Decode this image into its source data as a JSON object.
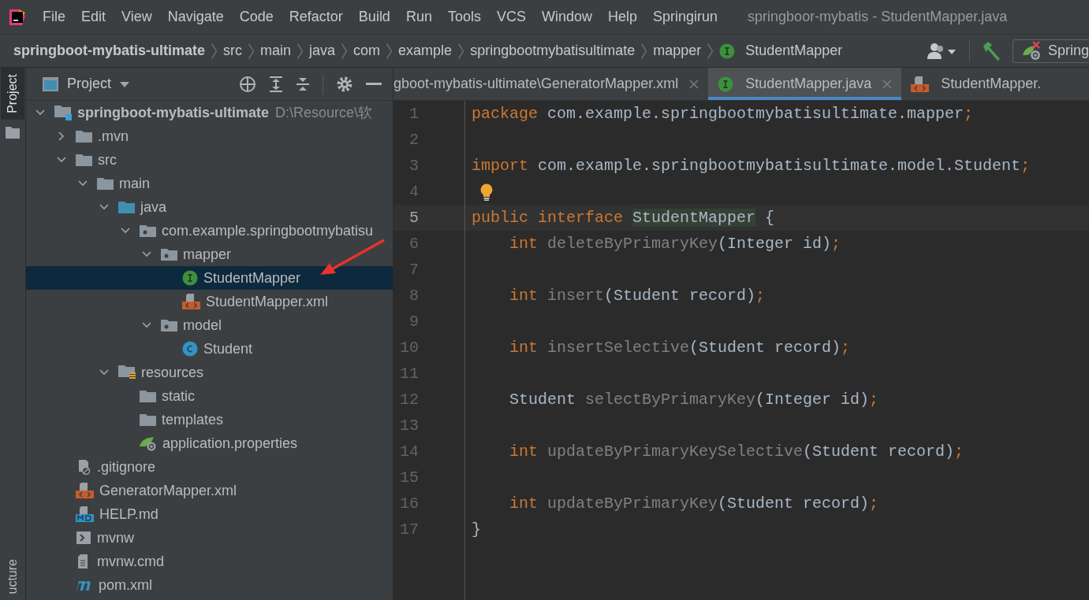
{
  "menu_bar": {
    "items": [
      "File",
      "Edit",
      "View",
      "Navigate",
      "Code",
      "Refactor",
      "Build",
      "Run",
      "Tools",
      "VCS",
      "Window",
      "Help",
      "Springirun"
    ],
    "title": "springboor-mybatis - StudentMapper.java"
  },
  "breadcrumb": {
    "items": [
      {
        "label": "springboot-mybatis-ultimate",
        "kind": "project"
      },
      {
        "label": "src",
        "kind": "dir"
      },
      {
        "label": "main",
        "kind": "dir"
      },
      {
        "label": "java",
        "kind": "dir"
      },
      {
        "label": "com",
        "kind": "dir"
      },
      {
        "label": "example",
        "kind": "dir"
      },
      {
        "label": "springbootmybatisultimate",
        "kind": "dir"
      },
      {
        "label": "mapper",
        "kind": "dir"
      },
      {
        "label": "StudentMapper",
        "kind": "interface"
      }
    ],
    "run_config": "Spring"
  },
  "tool_stripe": [
    {
      "label": "Project",
      "selected": true
    },
    {
      "label": "ucture",
      "selected": false
    }
  ],
  "project_panel": {
    "title": "Project",
    "tree": [
      {
        "label": "springboot-mybatis-ultimate",
        "path": "D:\\Resource\\软",
        "kind": "module",
        "expanded": true,
        "selected": false,
        "children": [
          {
            "label": ".mvn",
            "kind": "folder",
            "expanded": false,
            "selected": false
          },
          {
            "label": "src",
            "kind": "folder",
            "expanded": true,
            "selected": false,
            "children": [
              {
                "label": "main",
                "kind": "folder",
                "expanded": true,
                "selected": false,
                "children": [
                  {
                    "label": "java",
                    "kind": "source",
                    "expanded": true,
                    "selected": false,
                    "children": [
                      {
                        "label": "com.example.springbootmybatisu",
                        "kind": "package",
                        "expanded": true,
                        "selected": false,
                        "children": [
                          {
                            "label": "mapper",
                            "kind": "package",
                            "expanded": true,
                            "selected": false,
                            "children": [
                              {
                                "label": "StudentMapper",
                                "kind": "interface",
                                "selected": true
                              },
                              {
                                "label": "StudentMapper.xml",
                                "kind": "xml",
                                "selected": false
                              }
                            ]
                          },
                          {
                            "label": "model",
                            "kind": "package",
                            "expanded": true,
                            "selected": false,
                            "children": [
                              {
                                "label": "Student",
                                "kind": "class",
                                "selected": false
                              }
                            ]
                          }
                        ]
                      }
                    ]
                  },
                  {
                    "label": "resources",
                    "kind": "resources",
                    "expanded": true,
                    "selected": false,
                    "children": [
                      {
                        "label": "static",
                        "kind": "folder",
                        "selected": false
                      },
                      {
                        "label": "templates",
                        "kind": "folder",
                        "selected": false
                      },
                      {
                        "label": "application.properties",
                        "kind": "spring",
                        "selected": false
                      }
                    ]
                  }
                ]
              }
            ]
          },
          {
            "label": ".gitignore",
            "kind": "gitignore",
            "selected": false
          },
          {
            "label": "GeneratorMapper.xml",
            "kind": "xml",
            "selected": false
          },
          {
            "label": "HELP.md",
            "kind": "markdown",
            "selected": false
          },
          {
            "label": "mvnw",
            "kind": "script",
            "selected": false
          },
          {
            "label": "mvnw.cmd",
            "kind": "text",
            "selected": false
          },
          {
            "label": "pom.xml",
            "kind": "maven",
            "selected": false
          }
        ]
      }
    ]
  },
  "editor_tabs": [
    {
      "label": "gboot-mybatis-ultimate\\GeneratorMapper.xml",
      "selected": false,
      "closable": true
    },
    {
      "label": "StudentMapper.java",
      "kind": "interface",
      "selected": true,
      "closable": true
    },
    {
      "label": "StudentMapper.",
      "kind": "xml",
      "selected": false,
      "closable": false
    }
  ],
  "code": [
    {
      "number": "1",
      "current": false,
      "indented": false,
      "tokens": [
        {
          "text": "package ",
          "kind": "keyword"
        },
        {
          "text": "com.example.springbootmybatisultimate.mapper",
          "kind": "plain"
        },
        {
          "text": ";",
          "kind": "punct"
        }
      ]
    },
    {
      "number": "2",
      "current": false
    },
    {
      "number": "3",
      "current": false,
      "indented": false,
      "tokens": [
        {
          "text": "import ",
          "kind": "keyword"
        },
        {
          "text": "com.example.springbootmybatisultimate.model.Student",
          "kind": "plain"
        },
        {
          "text": ";",
          "kind": "punct"
        }
      ]
    },
    {
      "number": "4",
      "current": false,
      "lightbulb": true
    },
    {
      "number": "5",
      "current": true,
      "indented": false,
      "tokens": [
        {
          "text": "public interface ",
          "kind": "keyword"
        },
        {
          "text": "StudentMapper",
          "kind": "highlight"
        },
        {
          "text": " {",
          "kind": "plain"
        }
      ]
    },
    {
      "number": "6",
      "current": false,
      "indented": true,
      "tokens": [
        {
          "text": "int ",
          "kind": "keyword"
        },
        {
          "text": "deleteByPrimaryKey",
          "kind": "method"
        },
        {
          "text": "(Integer id)",
          "kind": "plain"
        },
        {
          "text": ";",
          "kind": "punct"
        }
      ]
    },
    {
      "number": "7",
      "current": false
    },
    {
      "number": "8",
      "current": false,
      "indented": true,
      "tokens": [
        {
          "text": "int ",
          "kind": "keyword"
        },
        {
          "text": "insert",
          "kind": "method"
        },
        {
          "text": "(Student record)",
          "kind": "plain"
        },
        {
          "text": ";",
          "kind": "punct"
        }
      ]
    },
    {
      "number": "9",
      "current": false
    },
    {
      "number": "10",
      "current": false,
      "indented": true,
      "tokens": [
        {
          "text": "int ",
          "kind": "keyword"
        },
        {
          "text": "insertSelective",
          "kind": "method"
        },
        {
          "text": "(Student record)",
          "kind": "plain"
        },
        {
          "text": ";",
          "kind": "punct"
        }
      ]
    },
    {
      "number": "11",
      "current": false
    },
    {
      "number": "12",
      "current": false,
      "indented": true,
      "tokens": [
        {
          "text": "Student ",
          "kind": "plain"
        },
        {
          "text": "selectByPrimaryKey",
          "kind": "method"
        },
        {
          "text": "(Integer id)",
          "kind": "plain"
        },
        {
          "text": ";",
          "kind": "punct"
        }
      ]
    },
    {
      "number": "13",
      "current": false
    },
    {
      "number": "14",
      "current": false,
      "indented": true,
      "tokens": [
        {
          "text": "int ",
          "kind": "keyword"
        },
        {
          "text": "updateByPrimaryKeySelective",
          "kind": "method"
        },
        {
          "text": "(Student record)",
          "kind": "plain"
        },
        {
          "text": ";",
          "kind": "punct"
        }
      ]
    },
    {
      "number": "15",
      "current": false
    },
    {
      "number": "16",
      "current": false,
      "indented": true,
      "tokens": [
        {
          "text": "int ",
          "kind": "keyword"
        },
        {
          "text": "updateByPrimaryKey",
          "kind": "method"
        },
        {
          "text": "(Student record)",
          "kind": "plain"
        },
        {
          "text": ";",
          "kind": "punct"
        }
      ]
    },
    {
      "number": "17",
      "current": false,
      "indented": false,
      "tokens": [
        {
          "text": "}",
          "kind": "plain"
        }
      ]
    }
  ]
}
